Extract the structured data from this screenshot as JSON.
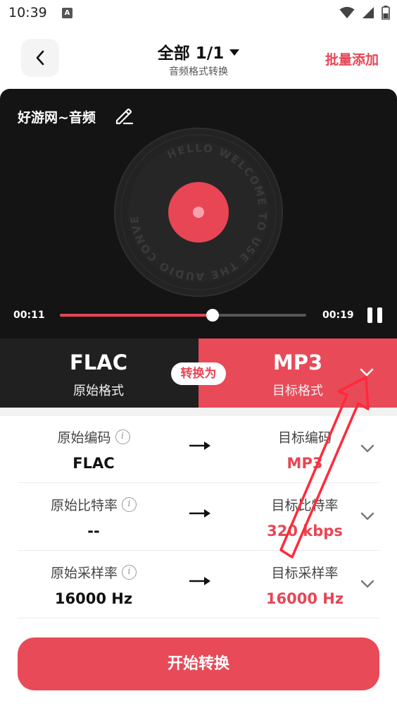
{
  "status_bar": {
    "time": "10:39",
    "notification_icon": "A"
  },
  "header": {
    "title": "全部 1/1",
    "subtitle": "音频格式转换",
    "batch_add_label": "批量添加"
  },
  "player": {
    "track_name": "好游网~音频",
    "vinyl_text": "HELLO WELCOME TO USE THE AUDIO CONVERTER",
    "current_time": "00:11",
    "total_time": "00:19",
    "progress": 0.62
  },
  "format": {
    "source_name": "FLAC",
    "source_label": "原始格式",
    "convert_label": "转换为",
    "target_name": "MP3",
    "target_label": "目标格式"
  },
  "params": [
    {
      "source_label": "原始编码",
      "source_value": "FLAC",
      "target_label": "目标编码",
      "target_value": "MP3"
    },
    {
      "source_label": "原始比特率",
      "source_value": "--",
      "target_label": "目标比特率",
      "target_value": "320 kbps"
    },
    {
      "source_label": "原始采样率",
      "source_value": "16000 Hz",
      "target_label": "目标采样率",
      "target_value": "16000 Hz"
    }
  ],
  "start_button_label": "开始转换",
  "colors": {
    "accent": "#e84555",
    "player_bg": "#141414",
    "source_bg": "#202020"
  }
}
